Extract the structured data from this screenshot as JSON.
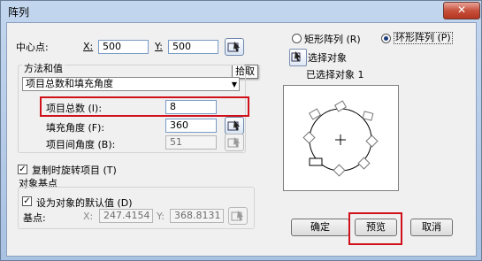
{
  "window": {
    "title": "阵列",
    "close_symbol": "✕"
  },
  "center": {
    "label": "中心点:",
    "x_label": "X:",
    "x_value": "500",
    "y_label": "Y:",
    "y_value": "500"
  },
  "tooltip": "拾取",
  "method": {
    "group_title": "方法和值",
    "selected": "项目总数和填充角度",
    "total_label": "项目总数 (I):",
    "total_value": "8",
    "fill_label": "填充角度 (F):",
    "fill_value": "360",
    "between_label": "项目间角度 (B):",
    "between_value": "51"
  },
  "rotate": {
    "label": "复制时旋转项目 (T)"
  },
  "base": {
    "group_title": "对象基点",
    "default_label": "设为对象的默认值 (D)",
    "point_label": "基点:",
    "x_label": "X:",
    "x_value": "247.4154",
    "y_label": "Y:",
    "y_value": "368.8131"
  },
  "array_type": {
    "rect_label": "矩形阵列 (R)",
    "polar_label": "环形阵列 (P)"
  },
  "select_objects": {
    "button_label": "选择对象",
    "status": "已选择对象 1"
  },
  "buttons": {
    "ok": "确定",
    "preview": "预览",
    "cancel": "取消"
  }
}
